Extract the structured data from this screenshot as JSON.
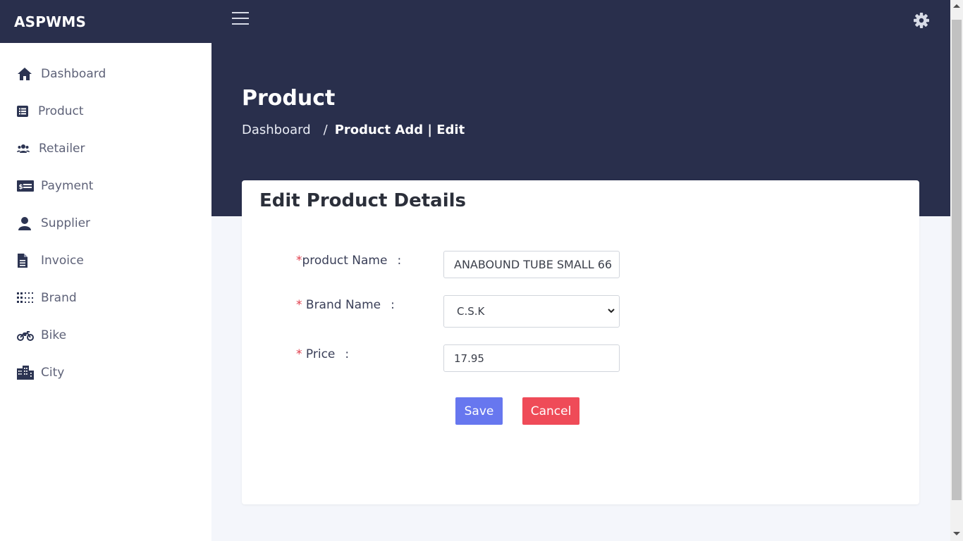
{
  "app": {
    "title": "ASPWMS"
  },
  "sidebar": {
    "items": [
      {
        "label": "Dashboard",
        "icon": "home-icon"
      },
      {
        "label": "Product",
        "icon": "list-icon"
      },
      {
        "label": "Retailer",
        "icon": "users-icon"
      },
      {
        "label": "Payment",
        "icon": "money-bill-icon"
      },
      {
        "label": "Supplier",
        "icon": "user-icon"
      },
      {
        "label": "Invoice",
        "icon": "file-icon"
      },
      {
        "label": "Brand",
        "icon": "grid-dots-icon"
      },
      {
        "label": "Bike",
        "icon": "motorcycle-icon"
      },
      {
        "label": "City",
        "icon": "city-icon"
      }
    ]
  },
  "header": {
    "page_title": "Product",
    "breadcrumb": {
      "home": "Dashboard",
      "separator": "/",
      "current": "Product Add | Edit"
    }
  },
  "card": {
    "title": "Edit Product Details",
    "fields": {
      "product_name": {
        "required_mark": "*",
        "label": "product Name",
        "colon": ":",
        "value": "ANABOUND TUBE SMALL  66"
      },
      "brand_name": {
        "required_mark": "*",
        "label": " Brand Name",
        "colon": ":",
        "value": "C.S.K"
      },
      "price": {
        "required_mark": "*",
        "label": " Price",
        "colon": ":",
        "value": "17.95"
      }
    },
    "save_label": "Save",
    "cancel_label": "Cancel"
  },
  "colors": {
    "header_bg": "#292f4c",
    "save": "#6777ef",
    "cancel": "#ef4b58",
    "required": "#e03e4c"
  }
}
